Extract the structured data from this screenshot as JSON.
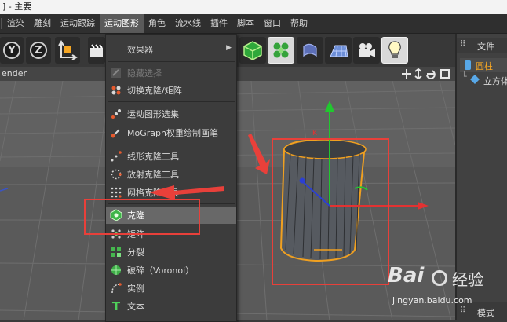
{
  "window": {
    "title": "] - 主要"
  },
  "menubar": {
    "items": [
      "渲染",
      "雕刻",
      "运动跟踪",
      "运动图形",
      "角色",
      "流水线",
      "插件",
      "脚本",
      "窗口",
      "帮助"
    ],
    "active": "运动图形"
  },
  "toolbar": {
    "axis_buttons": [
      "Y",
      "Z"
    ]
  },
  "viewport": {
    "bar_label": "ender"
  },
  "right_panel": {
    "tab_label": "文件",
    "objects": [
      {
        "label": "圆柱",
        "color": "#f5a623"
      },
      {
        "label": "立方体",
        "color": "#d0d0d0"
      }
    ],
    "bottom_label": "模式"
  },
  "dropdown": {
    "items": [
      {
        "label": "效果器",
        "icon": "submenu-icon",
        "submenu": true,
        "disabled": false
      },
      {
        "label": "隐藏选择",
        "icon": "hide-selection-icon",
        "disabled": true
      },
      {
        "label": "切换克隆/矩阵",
        "icon": "toggle-clone-matrix-icon",
        "disabled": false
      },
      {
        "label": "运动图形选集",
        "icon": "mograph-selection-icon",
        "disabled": false
      },
      {
        "label": "MoGraph权重绘制画笔",
        "icon": "weight-paint-brush-icon",
        "disabled": false
      },
      {
        "label": "线形克隆工具",
        "icon": "linear-clone-tool-icon",
        "disabled": false
      },
      {
        "label": "放射克隆工具",
        "icon": "radial-clone-tool-icon",
        "disabled": false
      },
      {
        "label": "网格克隆工具",
        "icon": "grid-clone-tool-icon",
        "disabled": false
      },
      {
        "label": "克隆",
        "icon": "cloner-icon",
        "disabled": false,
        "hover": true
      },
      {
        "label": "矩阵",
        "icon": "matrix-icon",
        "disabled": false
      },
      {
        "label": "分裂",
        "icon": "fracture-icon",
        "disabled": false
      },
      {
        "label": "破碎（Voronoi）",
        "icon": "voronoi-fracture-icon",
        "disabled": false
      },
      {
        "label": "实例",
        "icon": "instance-icon",
        "disabled": false
      },
      {
        "label": "文本",
        "icon": "text-icon",
        "disabled": false
      }
    ]
  },
  "watermark": {
    "brand": "Bai",
    "brand2": "经验",
    "url": "jingyan.baidu.com"
  },
  "colors": {
    "annotation": "#e8403a",
    "accent_orange": "#f5a623"
  }
}
